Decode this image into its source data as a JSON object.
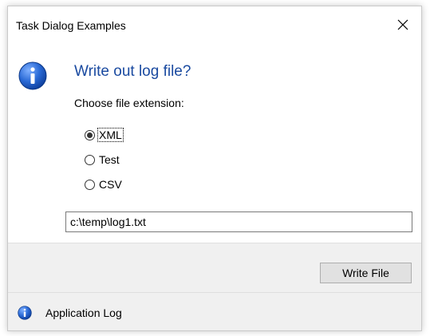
{
  "window": {
    "title": "Task Dialog Examples",
    "close_icon": "close-icon"
  },
  "content": {
    "icon": "information-icon",
    "main_instruction": "Write out log file?",
    "text": "Choose file extension:",
    "accent_color": "#1a4aa0",
    "radios": [
      {
        "label": "XML",
        "checked": true
      },
      {
        "label": "Test",
        "checked": false
      },
      {
        "label": "CSV",
        "checked": false
      }
    ],
    "file_path": "c:\\temp\\log1.txt"
  },
  "buttons": {
    "write_file": "Write File"
  },
  "footer": {
    "icon": "information-icon",
    "text": "Application Log"
  }
}
